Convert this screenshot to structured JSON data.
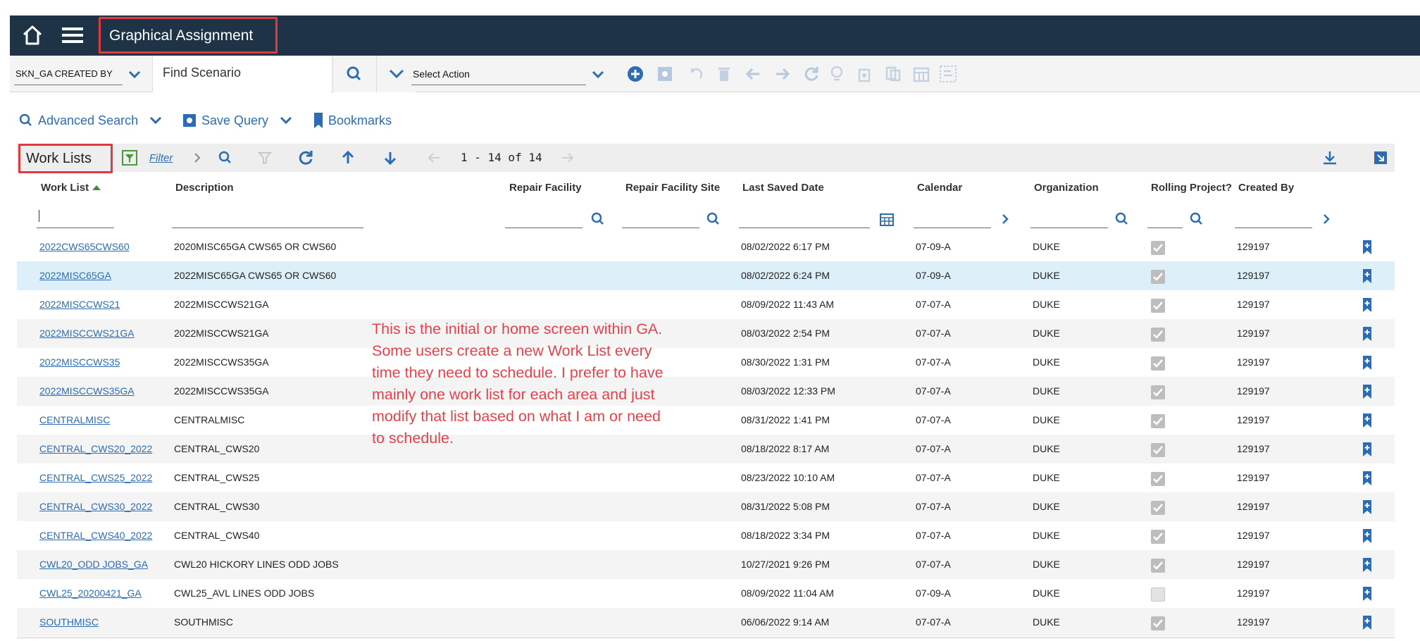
{
  "header": {
    "title": "Graphical Assignment",
    "home_icon": "home-icon",
    "menu_icon": "hamburger-menu-icon",
    "bg_color": "#1f3347"
  },
  "toolbar": {
    "scenario_filter": "SKN_GA CREATED BY",
    "find_scenario_placeholder": "Find Scenario",
    "action_select": "Select Action"
  },
  "subbar": {
    "advanced_search": "Advanced Search",
    "save_query": "Save Query",
    "bookmarks": "Bookmarks"
  },
  "worklist": {
    "title": "Work Lists",
    "filter_label": "Filter",
    "pager": "1 - 14 of 14"
  },
  "columns": [
    "Work List",
    "Description",
    "Repair Facility",
    "Repair Facility Site",
    "Last Saved Date",
    "Calendar",
    "Organization",
    "Rolling Project?",
    "Created By"
  ],
  "rows": [
    {
      "work_list": "2022CWS65CWS60",
      "description": "2020MISC65GA CWS65 OR CWS60",
      "last_saved": "08/02/2022 6:17 PM",
      "calendar": "07-09-A",
      "organization": "DUKE",
      "rolling": true,
      "created_by": "129197"
    },
    {
      "work_list": "2022MISC65GA",
      "description": "2022MISC65GA CWS65 OR CWS60",
      "last_saved": "08/02/2022 6:24 PM",
      "calendar": "07-09-A",
      "organization": "DUKE",
      "rolling": true,
      "created_by": "129197"
    },
    {
      "work_list": "2022MISCCWS21",
      "description": "2022MISCCWS21GA",
      "last_saved": "08/09/2022 11:43 AM",
      "calendar": "07-07-A",
      "organization": "DUKE",
      "rolling": true,
      "created_by": "129197"
    },
    {
      "work_list": "2022MISCCWS21GA",
      "description": "2022MISCCWS21GA",
      "last_saved": "08/03/2022 2:54 PM",
      "calendar": "07-07-A",
      "organization": "DUKE",
      "rolling": true,
      "created_by": "129197"
    },
    {
      "work_list": "2022MISCCWS35",
      "description": "2022MISCCWS35GA",
      "last_saved": "08/30/2022 1:31 PM",
      "calendar": "07-07-A",
      "organization": "DUKE",
      "rolling": true,
      "created_by": "129197"
    },
    {
      "work_list": "2022MISCCWS35GA",
      "description": "2022MISCCWS35GA",
      "last_saved": "08/03/2022 12:33 PM",
      "calendar": "07-07-A",
      "organization": "DUKE",
      "rolling": true,
      "created_by": "129197"
    },
    {
      "work_list": "CENTRALMISC",
      "description": "CENTRALMISC",
      "last_saved": "08/31/2022 1:41 PM",
      "calendar": "07-07-A",
      "organization": "DUKE",
      "rolling": true,
      "created_by": "129197"
    },
    {
      "work_list": "CENTRAL_CWS20_2022",
      "description": "CENTRAL_CWS20",
      "last_saved": "08/18/2022 8:17 AM",
      "calendar": "07-07-A",
      "organization": "DUKE",
      "rolling": true,
      "created_by": "129197"
    },
    {
      "work_list": "CENTRAL_CWS25_2022",
      "description": "CENTRAL_CWS25",
      "last_saved": "08/23/2022 10:10 AM",
      "calendar": "07-07-A",
      "organization": "DUKE",
      "rolling": true,
      "created_by": "129197"
    },
    {
      "work_list": "CENTRAL_CWS30_2022",
      "description": "CENTRAL_CWS30",
      "last_saved": "08/31/2022 5:08 PM",
      "calendar": "07-07-A",
      "organization": "DUKE",
      "rolling": true,
      "created_by": "129197"
    },
    {
      "work_list": "CENTRAL_CWS40_2022",
      "description": "CENTRAL_CWS40",
      "last_saved": "08/18/2022 3:34 PM",
      "calendar": "07-07-A",
      "organization": "DUKE",
      "rolling": true,
      "created_by": "129197"
    },
    {
      "work_list": "CWL20_ODD JOBS_GA",
      "description": "CWL20 HICKORY LINES ODD JOBS",
      "last_saved": "10/27/2021 9:26 PM",
      "calendar": "07-07-A",
      "organization": "DUKE",
      "rolling": true,
      "created_by": "129197"
    },
    {
      "work_list": "CWL25_20200421_GA",
      "description": "CWL25_AVL LINES ODD JOBS",
      "last_saved": "08/09/2022 11:04 AM",
      "calendar": "07-09-A",
      "organization": "DUKE",
      "rolling": false,
      "created_by": "129197"
    },
    {
      "work_list": "SOUTHMISC",
      "description": "SOUTHMISC",
      "last_saved": "06/06/2022 9:14 AM",
      "calendar": "07-07-A",
      "organization": "DUKE",
      "rolling": true,
      "created_by": "129197"
    }
  ],
  "selected_row": 1,
  "annotation": [
    "This is the initial or home screen within GA.",
    "Some users create a new Work List every",
    "time they need to schedule.  I prefer to have",
    "mainly one work list for each area and just",
    "modify that list based on what I am or need",
    "to schedule."
  ],
  "colors": {
    "link": "#2b6cb3",
    "highlight_box": "#e0393e",
    "annotation_text": "#e8404a",
    "selected_row": "#ddeff8"
  }
}
